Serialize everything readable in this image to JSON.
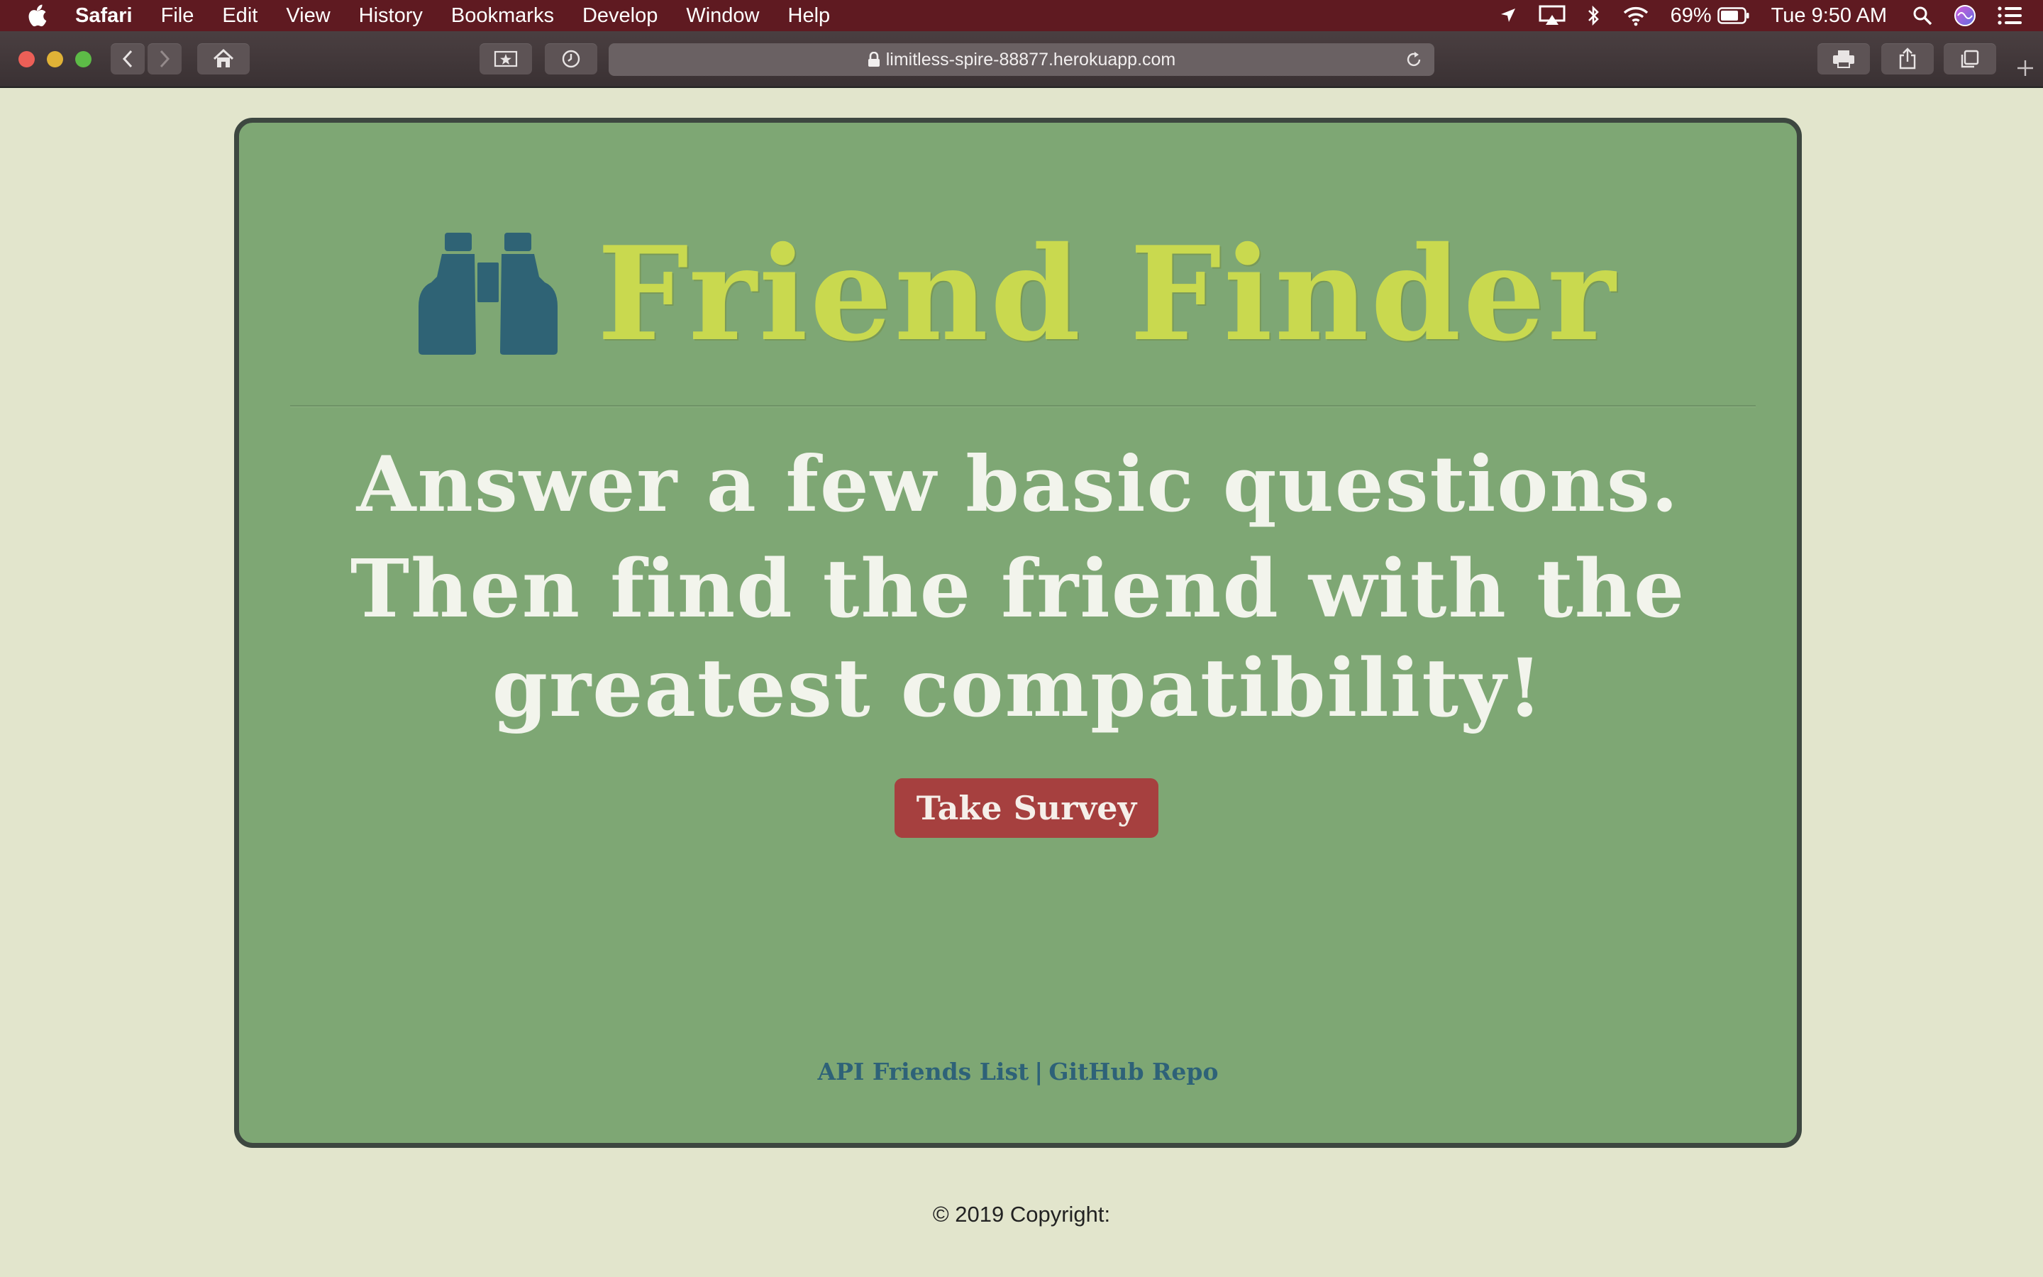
{
  "menubar": {
    "app_name": "Safari",
    "items": [
      "File",
      "Edit",
      "View",
      "History",
      "Bookmarks",
      "Develop",
      "Window",
      "Help"
    ],
    "battery": "69%",
    "clock": "Tue 9:50 AM",
    "status_icons": [
      "location-arrow-icon",
      "airplay-icon",
      "bluetooth-icon",
      "wifi-icon",
      "battery-icon",
      "spotlight-search-icon",
      "siri-icon",
      "control-center-icon"
    ]
  },
  "browser": {
    "url": "limitless-spire-88877.herokuapp.com",
    "colors": {
      "toolbar": "#3a3133",
      "menubar": "#5f1a21"
    }
  },
  "page": {
    "title": "Friend Finder",
    "tagline_1": "Answer a few basic questions.",
    "tagline_2": "Then find the friend with the greatest compatibility!",
    "survey_button": "Take Survey",
    "links": {
      "api": "API Friends List",
      "separator": "|",
      "github": "GitHub Repo"
    },
    "copyright": "© 2019 Copyright:",
    "colors": {
      "card": "#7ea774",
      "title": "#c9d94f",
      "button": "#a6403f",
      "icon": "#2f6375",
      "background": "#e2e5cc"
    }
  }
}
